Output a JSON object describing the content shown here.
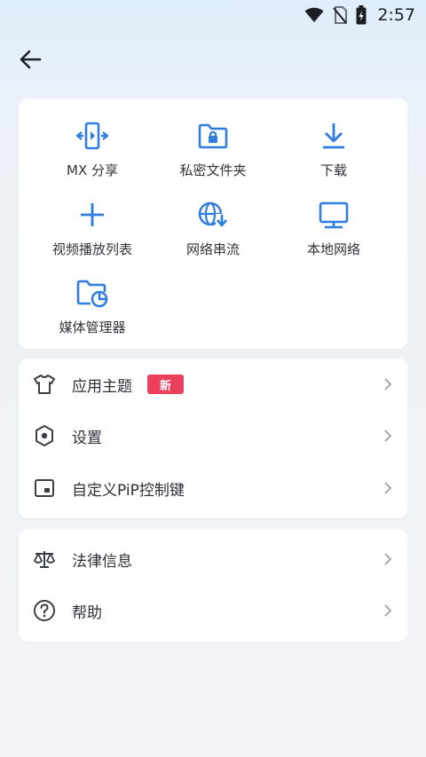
{
  "status_bar": {
    "time": "2:57",
    "icons": [
      "wifi-icon",
      "no-sim-icon",
      "battery-charging-icon"
    ]
  },
  "toolbar": {
    "back_icon": "arrow-left-icon"
  },
  "grid": {
    "accent_color": "#2f7de1",
    "items": [
      {
        "label": "MX 分享",
        "icon": "share-icon"
      },
      {
        "label": "私密文件夹",
        "icon": "lock-folder-icon"
      },
      {
        "label": "下载",
        "icon": "download-icon"
      },
      {
        "label": "视频播放列表",
        "icon": "plus-icon"
      },
      {
        "label": "网络串流",
        "icon": "globe-download-icon"
      },
      {
        "label": "本地网络",
        "icon": "monitor-icon"
      },
      {
        "label": "媒体管理器",
        "icon": "folder-chart-icon"
      }
    ]
  },
  "menu": {
    "items": [
      {
        "label": "应用主题",
        "icon": "shirt-icon",
        "badge": "新"
      },
      {
        "label": "设置",
        "icon": "hexagon-icon"
      },
      {
        "label": "自定义PiP控制键",
        "icon": "pip-icon"
      }
    ]
  },
  "menu2": {
    "items": [
      {
        "label": "法律信息",
        "icon": "scale-icon"
      },
      {
        "label": "帮助",
        "icon": "help-icon"
      }
    ]
  },
  "colors": {
    "badge": "#ec3f5b",
    "chevron": "#9aa0a8"
  }
}
